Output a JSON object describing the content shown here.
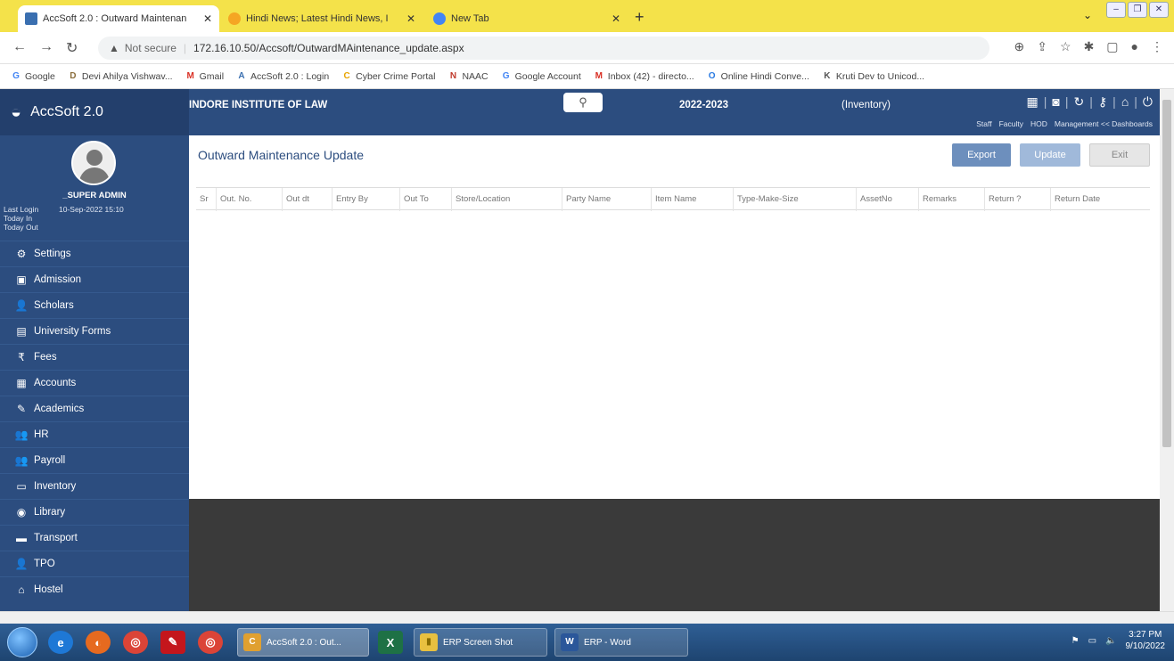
{
  "browser": {
    "tabs": [
      {
        "label": "AccSoft 2.0 : Outward Maintenan",
        "active": true,
        "color": "#3a6fb0"
      },
      {
        "label": "Hindi News; Latest Hindi News, I",
        "active": false,
        "color": "#f5a623"
      },
      {
        "label": "New Tab",
        "active": false,
        "color": "#4285f4"
      }
    ],
    "not_secure": "Not secure",
    "url": "172.16.10.50/Accsoft/OutwardMAintenance_update.aspx",
    "bookmarks": [
      {
        "label": "Google",
        "icon": "G",
        "color": "#4285f4"
      },
      {
        "label": "Devi Ahilya Vishwav...",
        "icon": "D",
        "color": "#8a6d3b"
      },
      {
        "label": "Gmail",
        "icon": "M",
        "color": "#d93025"
      },
      {
        "label": "AccSoft 2.0 : Login",
        "icon": "A",
        "color": "#3a6fb0"
      },
      {
        "label": "Cyber Crime Portal",
        "icon": "C",
        "color": "#e8a400"
      },
      {
        "label": "NAAC",
        "icon": "N",
        "color": "#c0392b"
      },
      {
        "label": "Google Account",
        "icon": "G",
        "color": "#4285f4"
      },
      {
        "label": "Inbox (42) - directo...",
        "icon": "M",
        "color": "#d93025"
      },
      {
        "label": "Online Hindi Conve...",
        "icon": "O",
        "color": "#2a7ae2"
      },
      {
        "label": "Kruti Dev to Unicod...",
        "icon": "K",
        "color": "#555"
      }
    ]
  },
  "header": {
    "brand": "AccSoft 2.0",
    "institute": "INDORE INSTITUTE OF LAW",
    "session": "2022-2023",
    "module": "(Inventory)",
    "links": [
      "Staff",
      "Faculty",
      "HOD",
      "Management << Dashboards"
    ]
  },
  "sidebar": {
    "username": "_SUPER ADMIN",
    "last_login_label": "Last Login",
    "last_login_value": "10-Sep-2022 15:10",
    "today_in": "Today In",
    "today_out": "Today Out",
    "items": [
      {
        "label": "Settings",
        "icon": "⚙"
      },
      {
        "label": "Admission",
        "icon": "▣"
      },
      {
        "label": "Scholars",
        "icon": "👤"
      },
      {
        "label": "University Forms",
        "icon": "▤"
      },
      {
        "label": "Fees",
        "icon": "₹"
      },
      {
        "label": "Accounts",
        "icon": "▦"
      },
      {
        "label": "Academics",
        "icon": "✎"
      },
      {
        "label": "HR",
        "icon": "👥"
      },
      {
        "label": "Payroll",
        "icon": "👥"
      },
      {
        "label": "Inventory",
        "icon": "▭"
      },
      {
        "label": "Library",
        "icon": "◉"
      },
      {
        "label": "Transport",
        "icon": "▬"
      },
      {
        "label": "TPO",
        "icon": "👤"
      },
      {
        "label": "Hostel",
        "icon": "⌂"
      }
    ]
  },
  "main": {
    "title": "Outward Maintenance Update",
    "export_label": "Export",
    "update_label": "Update",
    "exit_label": "Exit",
    "columns": [
      "Sr",
      "Out. No.",
      "Out dt",
      "Entry By",
      "Out To",
      "Store/Location",
      "Party Name",
      "Item Name",
      "Type-Make-Size",
      "AssetNo",
      "Remarks",
      "Return ?",
      "Return Date"
    ]
  },
  "taskbar": {
    "tasks": [
      {
        "label": "AccSoft 2.0 : Out...",
        "icon": "C",
        "color": "#e0a030"
      },
      {
        "label": "ERP Screen Shot",
        "icon": "▮",
        "color": "#e8c040"
      },
      {
        "label": "ERP - Word",
        "icon": "W",
        "color": "#2b579a"
      }
    ],
    "excel_icon": "X",
    "time": "3:27 PM",
    "date": "9/10/2022"
  }
}
